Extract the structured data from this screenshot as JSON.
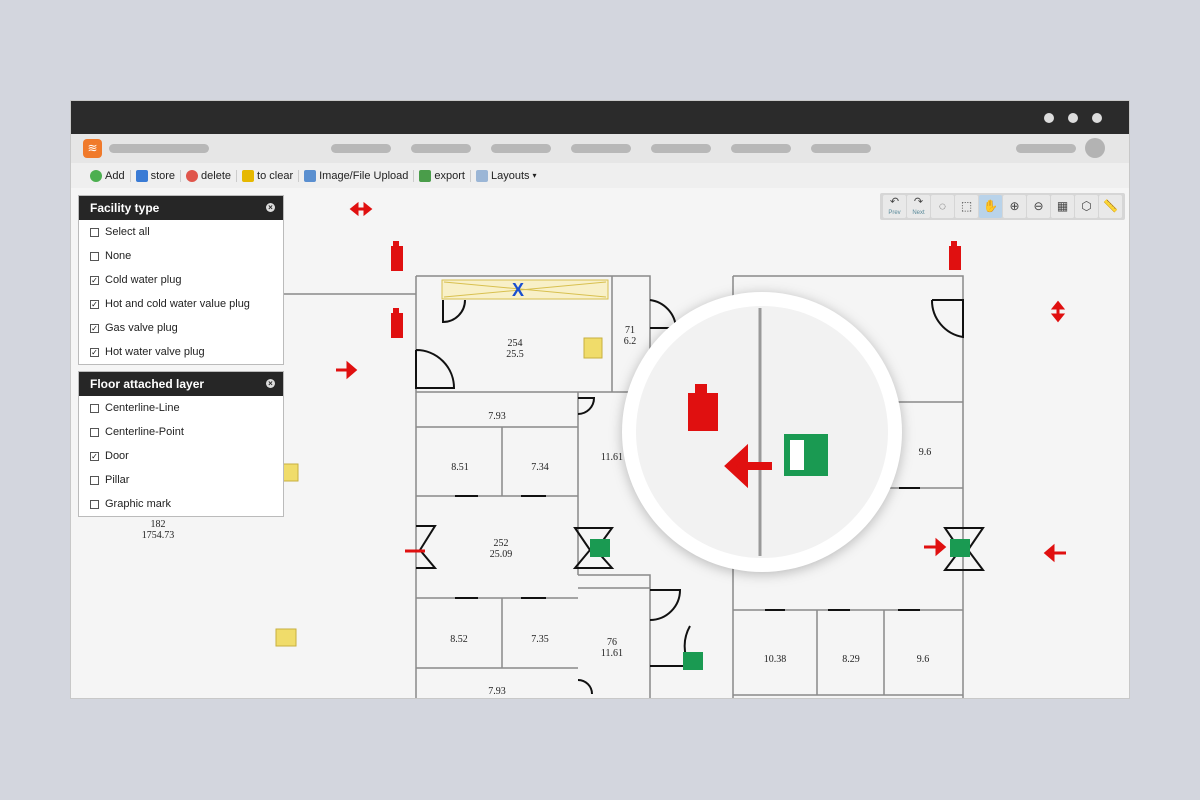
{
  "toolbar": {
    "items": [
      {
        "label": "Add",
        "icon": "add-icon",
        "color": "#4caf50"
      },
      {
        "label": "store",
        "icon": "save-icon",
        "color": "#3a7bd5"
      },
      {
        "label": "delete",
        "icon": "delete-icon",
        "color": "#e0554b"
      },
      {
        "label": "to clear",
        "icon": "broom-icon",
        "color": "#e6b800"
      },
      {
        "label": "Image/File Upload",
        "icon": "image-upload-icon",
        "color": "#5a8fd0"
      },
      {
        "label": "export",
        "icon": "export-icon",
        "color": "#4a9d4a"
      },
      {
        "label": "Layouts",
        "icon": "layout-icon",
        "color": "#9bb6d6"
      }
    ]
  },
  "map_tools": [
    {
      "name": "prev",
      "label": "Prev",
      "glyph": "↶"
    },
    {
      "name": "next",
      "label": "Next",
      "glyph": "↷"
    },
    {
      "name": "lasso-select",
      "glyph": "◌"
    },
    {
      "name": "rect-select",
      "glyph": "⬚"
    },
    {
      "name": "pan",
      "glyph": "✋",
      "active": true
    },
    {
      "name": "zoom-in",
      "glyph": "⊕"
    },
    {
      "name": "zoom-out",
      "glyph": "⊖"
    },
    {
      "name": "calculator",
      "glyph": "▦"
    },
    {
      "name": "polygon-measure",
      "glyph": "⬡"
    },
    {
      "name": "ruler",
      "glyph": "📏"
    }
  ],
  "facility_panel": {
    "title": "Facility type",
    "items": [
      {
        "label": "Select all",
        "checked": false
      },
      {
        "label": "None",
        "checked": false
      },
      {
        "label": "Cold water plug",
        "checked": true
      },
      {
        "label": "Hot and cold water value plug",
        "checked": true
      },
      {
        "label": "Gas valve plug",
        "checked": true
      },
      {
        "label": "Hot water valve plug",
        "checked": true
      }
    ]
  },
  "floor_panel": {
    "title": "Floor attached layer",
    "items": [
      {
        "label": "Centerline-Line",
        "checked": false
      },
      {
        "label": "Centerline-Point",
        "checked": false
      },
      {
        "label": "Door",
        "checked": true
      },
      {
        "label": "Pillar",
        "checked": false
      },
      {
        "label": "Graphic mark",
        "checked": false
      }
    ]
  },
  "rooms": {
    "r254a": "254",
    "r254b": "25.5",
    "r71a": "71",
    "r71b": "6.2",
    "r793a": "7.93",
    "r851": "8.51",
    "r734": "7.34",
    "r1161": "11.61",
    "r252a": "252",
    "r252b": "25.09",
    "r852": "8.52",
    "r735": "7.35",
    "r76a": "76",
    "r76b": "11.61",
    "r793b": "7.93",
    "r182a": "182",
    "r182b": "1754.73",
    "r96a": "9.6",
    "r1038": "10.38",
    "r829": "8.29",
    "r96b": "9.6"
  },
  "colors": {
    "fire": "#e01010",
    "exit": "#1a9a52",
    "plug": "#f0dc6a",
    "wall": "#888888"
  }
}
